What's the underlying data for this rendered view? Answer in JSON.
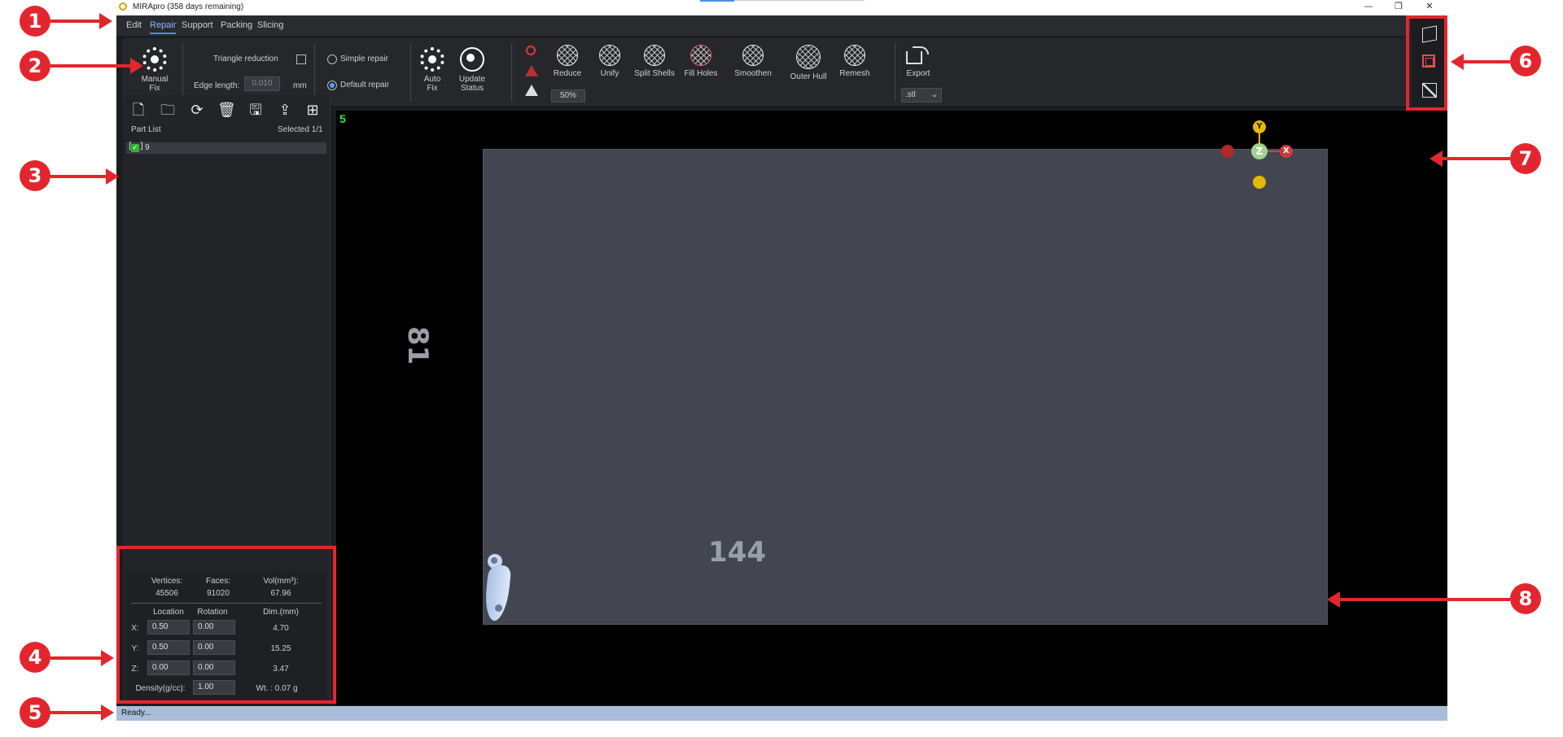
{
  "window": {
    "title": "MIRApro (358 days remaining)",
    "controls": [
      "—",
      "❐",
      "✕"
    ]
  },
  "menu": {
    "items": [
      "Edit",
      "Repair",
      "Support",
      "Packing",
      "Slicing"
    ],
    "active": "Repair"
  },
  "ribbon": {
    "manual_fix": "Manual\nFix",
    "triangle_reduction": "Triangle reduction",
    "edge_length_label": "Edge length:",
    "edge_length_value": "0.010",
    "edge_length_unit": "mm",
    "simple_repair": "Simple repair",
    "default_repair": "Default repair",
    "auto_fix": "Auto\nFix",
    "update_status": "Update\nStatus",
    "reduce": "Reduce",
    "reduce_percent": "50%",
    "unify": "Unify",
    "split_shells": "Split Shells",
    "fill_holes": "Fill Holes",
    "smoothen": "Smoothen",
    "outer_hull": "Outer Hull",
    "remesh": "Remesh",
    "export": "Export",
    "export_format": ".stl"
  },
  "left_panel": {
    "part_list_label": "Part List",
    "selected": "Selected 1/1",
    "parts": [
      {
        "name": "9",
        "checked": true
      }
    ]
  },
  "properties": {
    "vertices_label": "Vertices:",
    "vertices": "45506",
    "faces_label": "Faces:",
    "faces": "91020",
    "vol_label": "Vol(mm³):",
    "vol": "67.96",
    "location_label": "Location",
    "rotation_label": "Rotation",
    "dim_label": "Dim.(mm)",
    "rows": [
      {
        "axis": "X:",
        "location": "0.50",
        "rotation": "0.00",
        "dim": "4.70"
      },
      {
        "axis": "Y:",
        "location": "0.50",
        "rotation": "0.00",
        "dim": "15.25"
      },
      {
        "axis": "Z:",
        "location": "0.00",
        "rotation": "0.00",
        "dim": "3.47"
      }
    ],
    "density_label": "Density(g/cc):",
    "density": "1.00",
    "weight": "Wt. : 0.07 g"
  },
  "viewport": {
    "corner_number": "5",
    "plate_width_label": "144",
    "plate_height_label": "81",
    "axes": {
      "y": "Y",
      "z": "Z",
      "x": "X"
    }
  },
  "status": {
    "text": "Ready..."
  },
  "callouts": [
    "1",
    "2",
    "3",
    "4",
    "5",
    "6",
    "7",
    "8"
  ],
  "colors": {
    "annotation_red": "#e3262d",
    "accent_blue": "#4a90e2",
    "plate": "#434650"
  }
}
